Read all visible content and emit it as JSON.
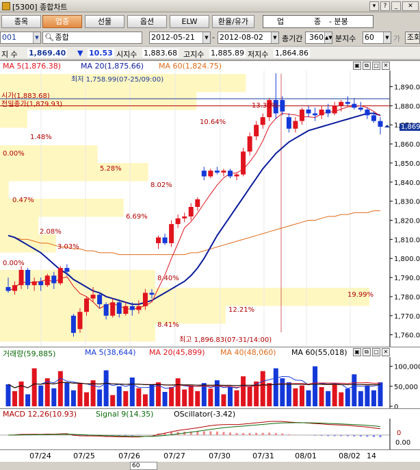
{
  "window": {
    "title": "[5300] 종합차트"
  },
  "tabs": [
    {
      "label": "종목",
      "active": false
    },
    {
      "label": "업종",
      "active": true
    },
    {
      "label": "선물",
      "active": false
    },
    {
      "label": "옵션",
      "active": false
    },
    {
      "label": "ELW",
      "active": false
    },
    {
      "label": "환율/유가",
      "active": false
    }
  ],
  "mode": {
    "a": "업",
    "b": "종",
    "c": "- 분봉"
  },
  "inputs": {
    "code": "001",
    "name": "종합",
    "date_from": "2012-05-21",
    "date_to": "2012-08-02",
    "total_period_label": "총기간",
    "total_period": "360",
    "interval_label": "분지수",
    "interval": "60",
    "extra_label": "가",
    "lookup_label": "조회"
  },
  "quote": {
    "label": "지 수",
    "price": "1,869.40",
    "change_arrow": "▼",
    "change": "10.53",
    "open_label": "시지수",
    "open": "1,883.68",
    "high_label": "고지수",
    "high": "1,885.89",
    "low_label": "저지수",
    "low": "1,864.86"
  },
  "price_legend": {
    "ma5": "MA 5(1,876.38)",
    "ma20": "MA 20(1,875.66)",
    "ma60": "MA 60(1,824.75)"
  },
  "annotations": {
    "low_note": "최저 1,758.99(07-25/09:00)",
    "high_note": "최고 1,896.83(07-31/14:00)",
    "open_price": "시가(1,883.68)",
    "prev_close": "전일종가(1,879.93)",
    "current_price": "1,869.4"
  },
  "volume_profile": [
    {
      "pct": "13.30%"
    },
    {
      "pct": "10.64%"
    },
    {
      "pct": "1.48%"
    },
    {
      "pct": "0.00%"
    },
    {
      "pct": "5.28%"
    },
    {
      "pct": "8.02%"
    },
    {
      "pct": "0.47%"
    },
    {
      "pct": "6.69%"
    },
    {
      "pct": "2.08%"
    },
    {
      "pct": "3.03%"
    },
    {
      "pct": "0.00%"
    },
    {
      "pct": "8.40%"
    },
    {
      "pct": "19.99%"
    },
    {
      "pct": "12.21%"
    },
    {
      "pct": "8.41%"
    }
  ],
  "volume_legend": {
    "vol": "거래량(59,885)",
    "ma5": "MA 5(38,644)",
    "ma20": "MA 20(45,899)",
    "ma40": "MA 40(48,060)",
    "ma60": "MA 60(55,018)"
  },
  "macd_legend": {
    "macd": "MACD 12,26(10.93)",
    "signal": "Signal 9(14.35)",
    "osc": "OScillator(-3.42)"
  },
  "bottom": {
    "interval": "60"
  },
  "colors": {
    "up": "#e0141e",
    "down": "#1438d8",
    "ma5": "#e0141e",
    "ma20": "#0a1a9a",
    "ma60": "#e06a1a",
    "profile": "#fff7c0"
  },
  "chart_data": {
    "type": "candlestick",
    "x_labels": [
      "07/24",
      "07/25",
      "07/26",
      "07/27",
      "07/30",
      "07/31",
      "08/01",
      "08/02",
      "14"
    ],
    "price_ticks": [
      "1,890.00",
      "1,880.00",
      "1,870.00",
      "1,860.00",
      "1,850.00",
      "1,840.00",
      "1,830.00",
      "1,820.00",
      "1,810.00",
      "1,800.00",
      "1,790.00",
      "1,780.00",
      "1,770.00",
      "1,760.00"
    ],
    "ylim": [
      1757,
      1897
    ],
    "volume_ticks": [
      "100,000",
      "50,000",
      "0"
    ],
    "volume_ylim": [
      0,
      120000
    ],
    "macd_ticks": [
      "0",
      "0.00"
    ],
    "candles": [
      {
        "o": 1785,
        "h": 1790,
        "l": 1782,
        "c": 1783
      },
      {
        "o": 1783,
        "h": 1788,
        "l": 1781,
        "c": 1786
      },
      {
        "o": 1786,
        "h": 1796,
        "l": 1784,
        "c": 1794
      },
      {
        "o": 1794,
        "h": 1795,
        "l": 1784,
        "c": 1786
      },
      {
        "o": 1786,
        "h": 1790,
        "l": 1783,
        "c": 1788
      },
      {
        "o": 1788,
        "h": 1790,
        "l": 1783,
        "c": 1786
      },
      {
        "o": 1786,
        "h": 1792,
        "l": 1785,
        "c": 1791
      },
      {
        "o": 1791,
        "h": 1793,
        "l": 1784,
        "c": 1787
      },
      {
        "o": 1787,
        "h": 1796,
        "l": 1786,
        "c": 1795
      },
      {
        "o": 1795,
        "h": 1797,
        "l": 1791,
        "c": 1793
      },
      {
        "o": 1770,
        "h": 1771,
        "l": 1759,
        "c": 1761
      },
      {
        "o": 1763,
        "h": 1774,
        "l": 1761,
        "c": 1772
      },
      {
        "o": 1772,
        "h": 1780,
        "l": 1770,
        "c": 1779
      },
      {
        "o": 1779,
        "h": 1785,
        "l": 1777,
        "c": 1781
      },
      {
        "o": 1781,
        "h": 1782,
        "l": 1774,
        "c": 1776
      },
      {
        "o": 1776,
        "h": 1777,
        "l": 1768,
        "c": 1770
      },
      {
        "o": 1770,
        "h": 1779,
        "l": 1769,
        "c": 1777
      },
      {
        "o": 1777,
        "h": 1778,
        "l": 1769,
        "c": 1771
      },
      {
        "o": 1771,
        "h": 1777,
        "l": 1770,
        "c": 1775
      },
      {
        "o": 1775,
        "h": 1777,
        "l": 1770,
        "c": 1773
      },
      {
        "o": 1773,
        "h": 1778,
        "l": 1771,
        "c": 1775
      },
      {
        "o": 1775,
        "h": 1784,
        "l": 1773,
        "c": 1782
      },
      {
        "o": 1782,
        "h": 1784,
        "l": 1779,
        "c": 1781
      },
      {
        "o": 1808,
        "h": 1812,
        "l": 1805,
        "c": 1811
      },
      {
        "o": 1811,
        "h": 1813,
        "l": 1807,
        "c": 1808
      },
      {
        "o": 1808,
        "h": 1820,
        "l": 1806,
        "c": 1818
      },
      {
        "o": 1818,
        "h": 1823,
        "l": 1816,
        "c": 1821
      },
      {
        "o": 1821,
        "h": 1824,
        "l": 1819,
        "c": 1822
      },
      {
        "o": 1822,
        "h": 1829,
        "l": 1820,
        "c": 1827
      },
      {
        "o": 1827,
        "h": 1832,
        "l": 1825,
        "c": 1831
      },
      {
        "o": 1846,
        "h": 1848,
        "l": 1841,
        "c": 1843
      },
      {
        "o": 1843,
        "h": 1847,
        "l": 1842,
        "c": 1846
      },
      {
        "o": 1846,
        "h": 1848,
        "l": 1844,
        "c": 1845
      },
      {
        "o": 1845,
        "h": 1847,
        "l": 1843,
        "c": 1846
      },
      {
        "o": 1846,
        "h": 1847,
        "l": 1842,
        "c": 1843
      },
      {
        "o": 1843,
        "h": 1845,
        "l": 1841,
        "c": 1844
      },
      {
        "o": 1844,
        "h": 1858,
        "l": 1843,
        "c": 1856
      },
      {
        "o": 1856,
        "h": 1866,
        "l": 1854,
        "c": 1864
      },
      {
        "o": 1864,
        "h": 1872,
        "l": 1862,
        "c": 1870
      },
      {
        "o": 1870,
        "h": 1876,
        "l": 1868,
        "c": 1874
      },
      {
        "o": 1874,
        "h": 1884,
        "l": 1872,
        "c": 1883
      },
      {
        "o": 1883,
        "h": 1897,
        "l": 1873,
        "c": 1876
      },
      {
        "o": 1883,
        "h": 1885,
        "l": 1875,
        "c": 1877
      },
      {
        "o": 1874,
        "h": 1876,
        "l": 1866,
        "c": 1868
      },
      {
        "o": 1868,
        "h": 1874,
        "l": 1866,
        "c": 1872
      },
      {
        "o": 1872,
        "h": 1879,
        "l": 1870,
        "c": 1878
      },
      {
        "o": 1878,
        "h": 1880,
        "l": 1874,
        "c": 1876
      },
      {
        "o": 1876,
        "h": 1879,
        "l": 1872,
        "c": 1875
      },
      {
        "o": 1875,
        "h": 1880,
        "l": 1873,
        "c": 1878
      },
      {
        "o": 1878,
        "h": 1881,
        "l": 1874,
        "c": 1876
      },
      {
        "o": 1876,
        "h": 1882,
        "l": 1875,
        "c": 1880
      },
      {
        "o": 1880,
        "h": 1883,
        "l": 1877,
        "c": 1882
      },
      {
        "o": 1882,
        "h": 1885,
        "l": 1880,
        "c": 1881
      },
      {
        "o": 1881,
        "h": 1884,
        "l": 1878,
        "c": 1879
      },
      {
        "o": 1879,
        "h": 1882,
        "l": 1877,
        "c": 1878
      },
      {
        "o": 1878,
        "h": 1879,
        "l": 1873,
        "c": 1875
      },
      {
        "o": 1875,
        "h": 1877,
        "l": 1871,
        "c": 1872
      },
      {
        "o": 1872,
        "h": 1874,
        "l": 1865,
        "c": 1869
      }
    ],
    "ma20": [
      1812,
      1811,
      1809,
      1807,
      1805,
      1803,
      1800,
      1797,
      1794,
      1792,
      1789,
      1787,
      1785,
      1783,
      1782,
      1780,
      1779,
      1778,
      1777,
      1776,
      1776,
      1777,
      1778,
      1780,
      1782,
      1784,
      1786,
      1788,
      1791,
      1795,
      1800,
      1806,
      1812,
      1817,
      1822,
      1827,
      1832,
      1837,
      1842,
      1847,
      1851,
      1855,
      1858,
      1861,
      1863,
      1865,
      1867,
      1868,
      1869,
      1870,
      1871,
      1872,
      1873,
      1874,
      1875,
      1876,
      1876,
      1875
    ],
    "ma60": [
      1812,
      1811,
      1810,
      1810,
      1809,
      1808,
      1808,
      1807,
      1806,
      1806,
      1805,
      1805,
      1804,
      1804,
      1803,
      1803,
      1803,
      1802,
      1802,
      1802,
      1802,
      1802,
      1802,
      1802,
      1802,
      1802,
      1802,
      1802,
      1803,
      1803,
      1804,
      1805,
      1806,
      1807,
      1808,
      1809,
      1810,
      1811,
      1812,
      1813,
      1814,
      1815,
      1816,
      1817,
      1818,
      1819,
      1820,
      1820,
      1821,
      1822,
      1822,
      1823,
      1823,
      1824,
      1824,
      1824,
      1825,
      1825
    ],
    "volumes": [
      55000,
      38000,
      62000,
      30000,
      95000,
      52000,
      70000,
      45000,
      88000,
      60000,
      40000,
      58000,
      35000,
      65000,
      42000,
      90000,
      28000,
      50000,
      38000,
      72000,
      45000,
      30000,
      55000,
      60000,
      36000,
      48000,
      70000,
      42000,
      52000,
      38000,
      58000,
      44000,
      65000,
      30000,
      48000,
      40000,
      75000,
      50000,
      62000,
      88000,
      58000,
      95000,
      70000,
      60000,
      45000,
      52000,
      40000,
      100000,
      48000,
      38000,
      56000,
      35000,
      44000,
      80000,
      38000,
      52000,
      40000,
      59885
    ]
  }
}
